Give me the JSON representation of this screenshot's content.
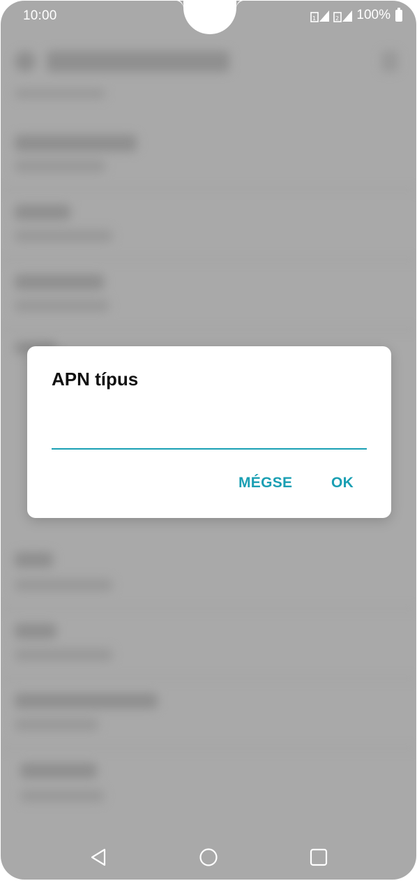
{
  "status_bar": {
    "time": "10:00",
    "battery_percent": "100%"
  },
  "dialog": {
    "title": "APN típus",
    "input_value": "",
    "cancel_label": "MÉGSE",
    "ok_label": "OK"
  },
  "colors": {
    "accent": "#1a9fb3",
    "scrim": "#a9a9a9",
    "dialog_background": "#ffffff"
  },
  "nav_bar": {
    "icons": [
      "back-icon",
      "home-icon",
      "recent-apps-icon"
    ]
  }
}
